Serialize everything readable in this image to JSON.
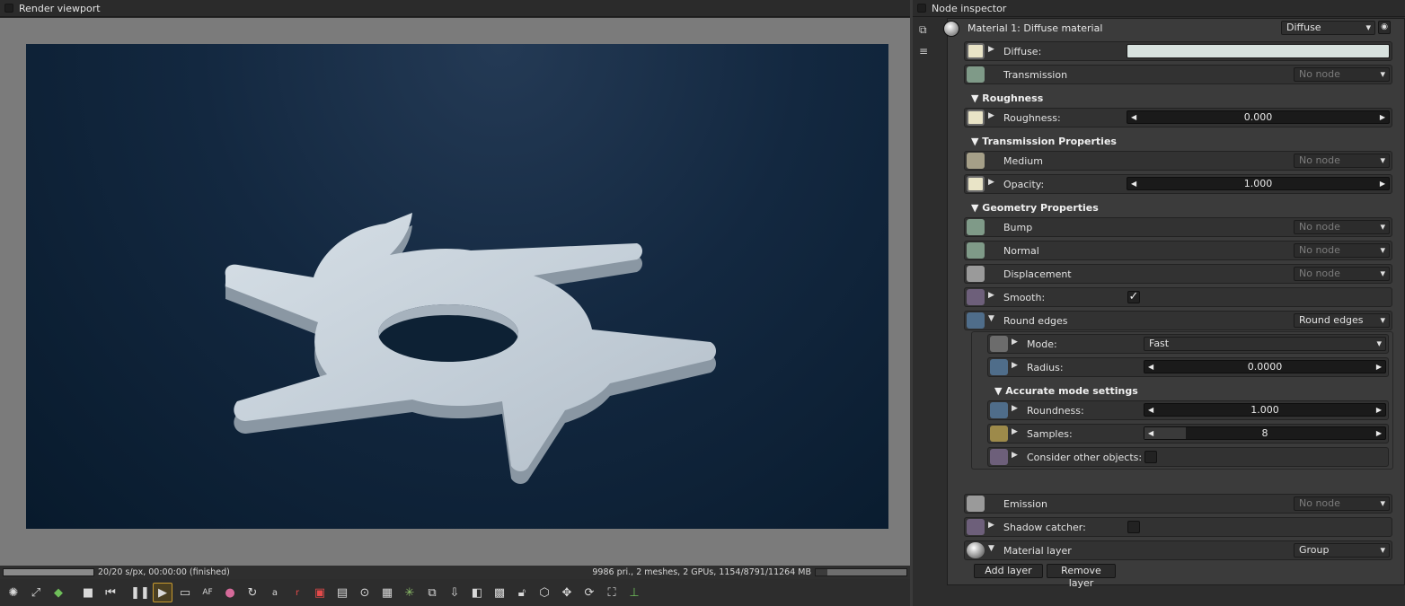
{
  "viewport": {
    "title": "Render viewport",
    "status_left": "20/20 s/px, 00:00:00 (finished)",
    "status_right": "9986 pri., 2 meshes, 2 GPUs, 1154/8791/11264 MB",
    "progress": 1.0,
    "memory_usage": 0.13,
    "toolbar": [
      "octane-logo-icon",
      "fit-icon",
      "cube-icon",
      "stop-icon",
      "rewind-icon",
      "pause-icon",
      "play-icon",
      "monitor-icon",
      "af-icon",
      "color-icon",
      "refresh-icon",
      "a-pick-icon",
      "r-pick-icon",
      "focus-pick-icon",
      "white-pick-icon",
      "lock-zoom-icon",
      "region-icon",
      "spinner-icon",
      "copy-icon",
      "export-icon",
      "clay-icon",
      "checker-icon",
      "lock-icon",
      "box-icon",
      "move-icon",
      "rotate-icon",
      "fullscreen-icon",
      "axes-icon"
    ]
  },
  "inspector": {
    "title": "Node inspector",
    "material_title": "Material 1: Diffuse material",
    "material_type": "Diffuse",
    "diffuse_label": "Diffuse:",
    "diffuse_color": "#d8e2df",
    "transmission_label": "Transmission",
    "no_node": "No node",
    "roughness_section": "▼ Roughness",
    "roughness_label": "Roughness:",
    "roughness_value": "0.000",
    "transmission_section": "▼ Transmission Properties",
    "medium_label": "Medium",
    "opacity_label": "Opacity:",
    "opacity_value": "1.000",
    "geometry_section": "▼ Geometry Properties",
    "bump_label": "Bump",
    "normal_label": "Normal",
    "displacement_label": "Displacement",
    "smooth_label": "Smooth:",
    "smooth_checked": "✓",
    "round_edges_label": "Round edges",
    "round_edges_value": "Round edges",
    "mode_label": "Mode:",
    "mode_value": "Fast",
    "radius_label": "Radius:",
    "radius_value": "0.0000",
    "accurate_section": "▼ Accurate mode settings",
    "roundness_label": "Roundness:",
    "roundness_value": "1.000",
    "samples_label": "Samples:",
    "samples_value": "8",
    "samples_fraction": 0.17,
    "consider_label": "Consider other objects:",
    "emission_label": "Emission",
    "shadow_label": "Shadow catcher:",
    "material_layer_label": "Material layer",
    "material_layer_value": "Group",
    "add_layer": "Add layer",
    "remove_layer": "Remove layer"
  }
}
